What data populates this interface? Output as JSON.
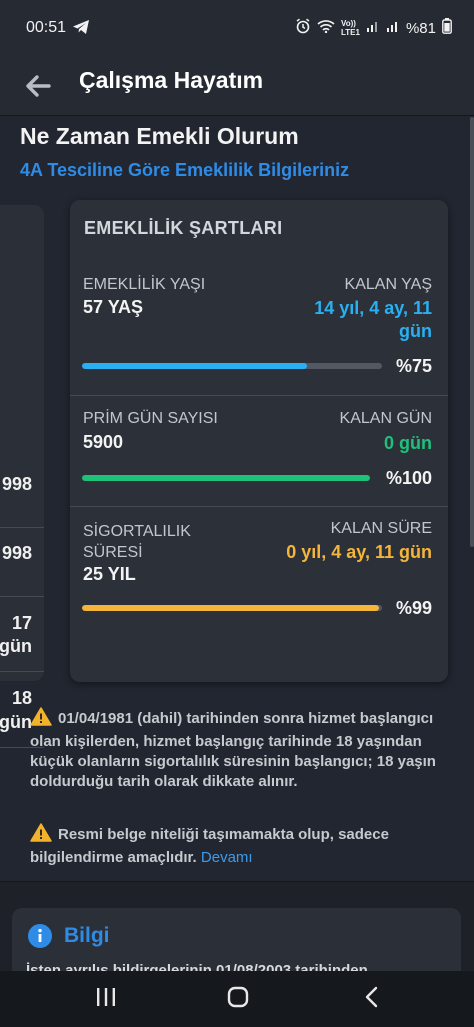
{
  "status_bar": {
    "time": "00:51",
    "telegram_icon": "telegram-icon",
    "battery_text": "%81",
    "network_label_top": "Vo))",
    "network_label_bottom": "LTE1"
  },
  "app_bar": {
    "back_icon": "arrow-left-icon",
    "title": "Çalışma Hayatım"
  },
  "page": {
    "heading": "Ne Zaman Emekli Olurum",
    "subheading": "4A Tesciline Göre Emeklilik Bilgileriniz"
  },
  "left_card": {
    "values": [
      "998",
      "998",
      "17",
      "gün",
      "18",
      "gün"
    ]
  },
  "conditions_card": {
    "title": "EMEKLİLİK ŞARTLARI",
    "sections": [
      {
        "label": "EMEKLİLİK YAŞI",
        "value": "57 YAŞ",
        "remaining_label": "KALAN YAŞ",
        "remaining_line1": "14 yıl, 4 ay, 11",
        "remaining_line2": "gün",
        "remaining_color": "#29b0f2",
        "progress": 0.75,
        "percent_text": "%75",
        "bar_color": "#29b0f2"
      },
      {
        "label": "PRİM GÜN SAYISI",
        "value": "5900",
        "remaining_label": "KALAN GÜN",
        "remaining_line1": "0 gün",
        "remaining_color": "#1fc07a",
        "progress": 1.0,
        "percent_text": "%100",
        "bar_color": "#1fc07a"
      },
      {
        "label_line1": "SİGORTALILIK",
        "label_line2": "SÜRESİ",
        "value": "25 YIL",
        "remaining_label": "KALAN SÜRE",
        "remaining_line1": "0 yıl, 4 ay, 11 gün",
        "remaining_color": "#f5b43a",
        "progress": 0.99,
        "percent_text": "%99",
        "bar_color": "#f5b43a"
      }
    ]
  },
  "notes": {
    "note1": "01/04/1981 (dahil) tarihinden sonra hizmet başlangıcı olan kişilerden, hizmet başlangıç tarihinde 18 yaşından küçük olanların sigortalılık süresinin başlangıcı; 18 yaşın doldurduğu tarih olarak dikkate alınır.",
    "note2": "Resmi belge niteliği taşımamakta olup, sadece bilgilendirme amaçlıdır.",
    "note2_link": "Devamı",
    "warning_icon": "warning-icon",
    "warning_color": "#f2b32a"
  },
  "info_card": {
    "icon": "info-icon",
    "title": "Bilgi",
    "text_partial": "İşten ayrılış bildirgelerinin 01/08/2003 tarihinden"
  },
  "nav_bar": {
    "recents_icon": "recents-icon",
    "home_icon": "home-icon",
    "back_icon": "back-chevron-icon"
  },
  "colors": {
    "accent_blue": "#2f8ce6",
    "background": "#222630",
    "card": "#2c3139"
  }
}
